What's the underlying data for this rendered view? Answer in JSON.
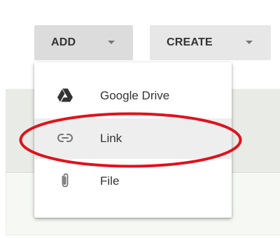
{
  "toolbar": {
    "add_label": "ADD",
    "create_label": "CREATE"
  },
  "add_menu": {
    "items": [
      {
        "label": "Google Drive",
        "icon": "google-drive-icon"
      },
      {
        "label": "Link",
        "icon": "link-icon"
      },
      {
        "label": "File",
        "icon": "paperclip-icon"
      }
    ]
  },
  "colors": {
    "highlight_annotation": "#e0121b",
    "hovered_item_bg": "#eeeeee",
    "button_bg": "#e7e7e7",
    "active_button_bg": "#dcdcdc"
  }
}
